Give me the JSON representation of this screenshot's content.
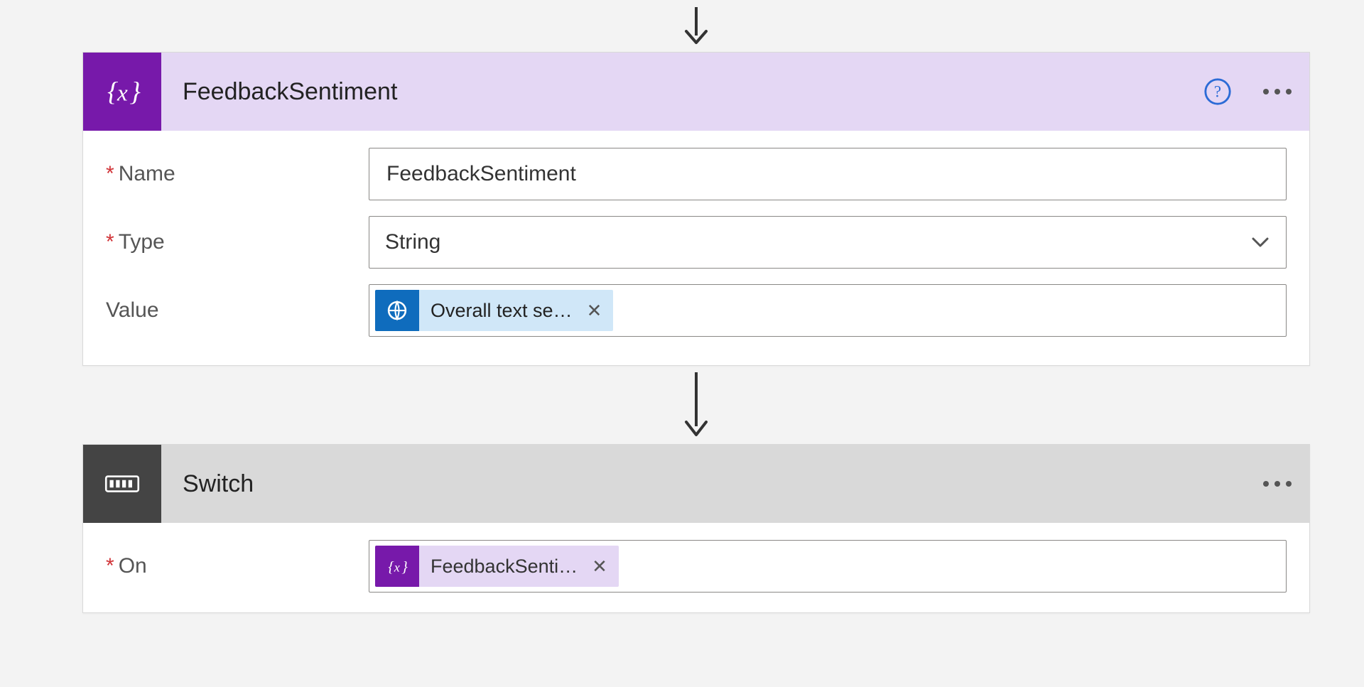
{
  "colors": {
    "variable_accent": "#7719aa",
    "ai_accent": "#0f6cbd",
    "switch_accent": "#444444"
  },
  "variable_card": {
    "title": "FeedbackSentiment",
    "fields": {
      "name": {
        "label": "Name",
        "required": true,
        "value": "FeedbackSentiment"
      },
      "type": {
        "label": "Type",
        "required": true,
        "value": "String"
      },
      "value": {
        "label": "Value",
        "required": false,
        "token": {
          "kind": "ai",
          "label": "Overall text se…"
        }
      }
    }
  },
  "switch_card": {
    "title": "Switch",
    "fields": {
      "on": {
        "label": "On",
        "required": true,
        "token": {
          "kind": "var",
          "label": "FeedbackSenti…"
        }
      }
    }
  }
}
